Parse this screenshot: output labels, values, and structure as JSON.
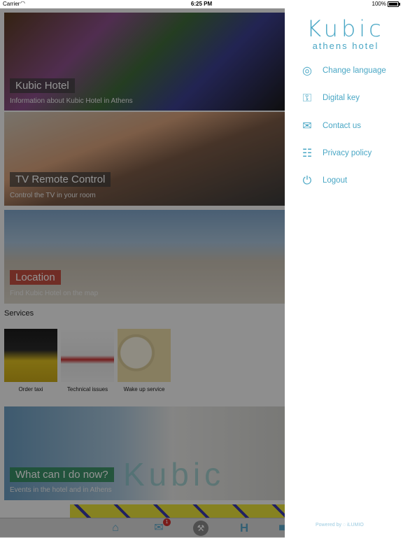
{
  "status_bar": {
    "carrier": "Carrier",
    "time": "6:25 PM",
    "battery": "100%",
    "battery_level": 1.0
  },
  "cards": [
    {
      "title": "Kubic Hotel",
      "subtitle": "Information about Kubic Hotel in Athens"
    },
    {
      "title": "TV Remote Control",
      "subtitle": "Control the TV in your room"
    },
    {
      "title": "Location",
      "subtitle": "Find Kubic Hotel on the map",
      "accent": "#c0392b"
    },
    {
      "title": "What can I do now?",
      "subtitle": "Events in the hotel and in Athens",
      "accent": "#2e8b57",
      "bg_text": "Kubic"
    }
  ],
  "services": {
    "label": "Services",
    "items": [
      {
        "label": "Order taxi"
      },
      {
        "label": "Technical issues"
      },
      {
        "label": "Wake up service"
      }
    ]
  },
  "tab_bar": {
    "chat_badge": "1",
    "icons": [
      "home-icon",
      "chat-icon",
      "key-icon",
      "hotel-icon"
    ],
    "h_label": "H"
  },
  "menu": {
    "logo_brand": "Kubic",
    "logo_sub": "athens hotel",
    "items": [
      {
        "label": "Change language",
        "icon": "globe-icon"
      },
      {
        "label": "Digital key",
        "icon": "key-icon"
      },
      {
        "label": "Contact us",
        "icon": "envelope-icon"
      },
      {
        "label": "Privacy policy",
        "icon": "document-icon"
      },
      {
        "label": "Logout",
        "icon": "power-icon"
      }
    ],
    "powered_by": "Powered by",
    "powered_brand": "iLUMIO"
  },
  "colors": {
    "accent": "#4aa7c5",
    "overlay": "rgba(0,0,0,0.42)"
  }
}
